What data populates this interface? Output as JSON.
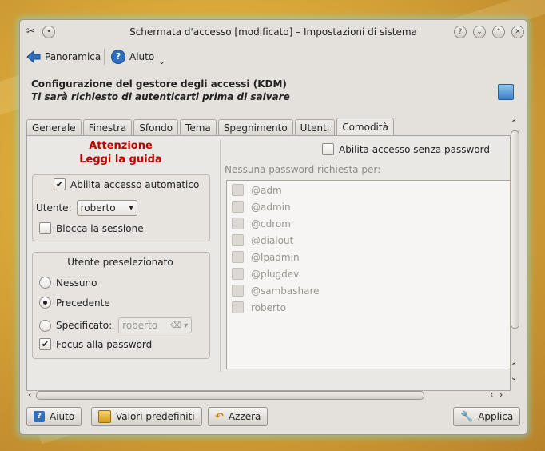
{
  "window": {
    "title": "Schermata d'accesso [modificato] – Impostazioni di sistema",
    "controls": {
      "help": "?",
      "shade": "⌄",
      "maximize": "⌃",
      "close": "✕"
    }
  },
  "toolbar": {
    "overview_label": "Panoramica",
    "help_label": "Aiuto"
  },
  "header": {
    "title": "Configurazione del gestore degli accessi (KDM)",
    "subtitle": "Ti sarà richiesto di autenticarti prima di salvare"
  },
  "tabs": [
    {
      "label": "Generale",
      "active": false
    },
    {
      "label": "Finestra",
      "active": false
    },
    {
      "label": "Sfondo",
      "active": false
    },
    {
      "label": "Tema",
      "active": false
    },
    {
      "label": "Spegnimento",
      "active": false
    },
    {
      "label": "Utenti",
      "active": false
    },
    {
      "label": "Comodità",
      "active": true
    }
  ],
  "warning": {
    "line1": "Attenzione",
    "line2": "Leggi la guida"
  },
  "autologin": {
    "checkbox_label": "Abilita accesso automatico",
    "checked": true,
    "user_label": "Utente:",
    "user_value": "roberto",
    "lock_label": "Blocca la sessione",
    "lock_checked": false
  },
  "preselected": {
    "title": "Utente preselezionato",
    "options": [
      {
        "label": "Nessuno",
        "selected": false
      },
      {
        "label": "Precedente",
        "selected": true
      },
      {
        "label": "Specificato:",
        "selected": false
      }
    ],
    "specified_value": "roberto",
    "focus_label": "Focus alla password",
    "focus_checked": true
  },
  "nopassword": {
    "checkbox_label": "Abilita accesso senza password",
    "checked": false,
    "list_label": "Nessuna password richiesta per:",
    "items": [
      "@adm",
      "@admin",
      "@cdrom",
      "@dialout",
      "@lpadmin",
      "@plugdev",
      "@sambashare",
      "roberto"
    ]
  },
  "buttons": {
    "help": "Aiuto",
    "defaults": "Valori predefiniti",
    "reset": "Azzera",
    "apply": "Applica"
  }
}
